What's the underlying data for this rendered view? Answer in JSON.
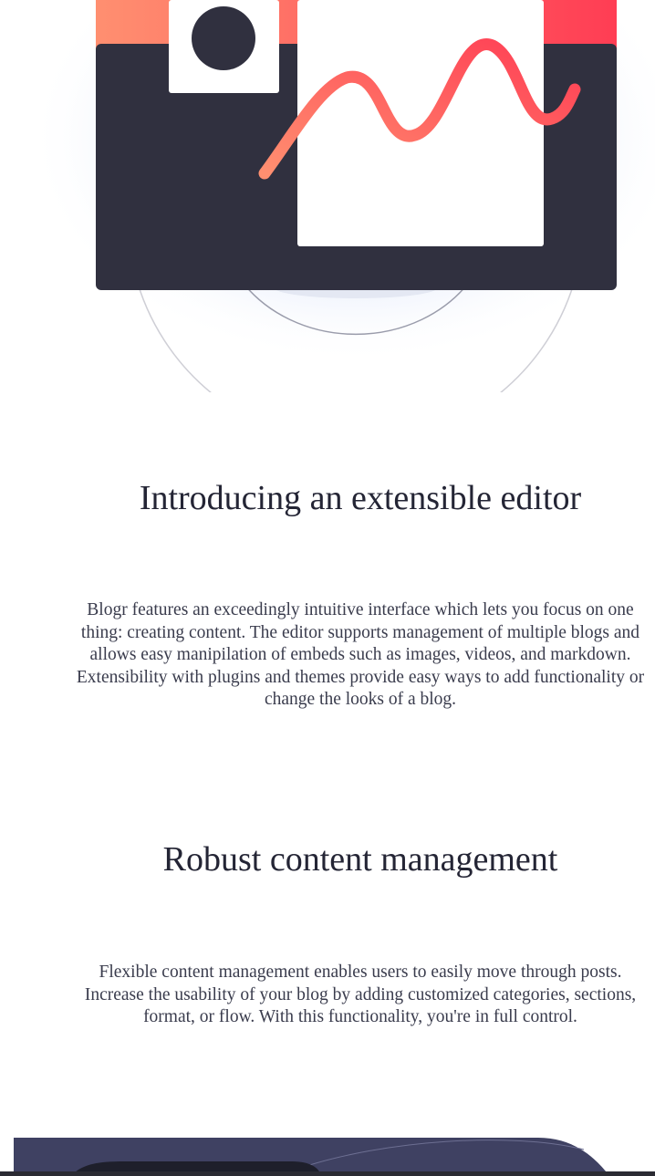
{
  "sections": [
    {
      "title": "Introducing an extensible editor",
      "body": "Blogr features an exceedingly intuitive interface which lets you focus on one thing: creating content. The editor supports management of multiple blogs and allows easy manipilation of embeds such as images, videos, and markdown. Extensibility with plugins and themes provide easy ways to add functionality or change the looks of a blog."
    },
    {
      "title": "Robust content management",
      "body": "Flexible content management enables users to easily move through posts. Increase the usability of your blog by adding customized categories, sections, format, or flow. With this functionality, you're in full control."
    }
  ],
  "colors": {
    "dark_navy": "#30303f",
    "accent_gradient_start": "#ff8f70",
    "accent_gradient_end": "#ff3d54",
    "footer_band": "#3f4162"
  }
}
